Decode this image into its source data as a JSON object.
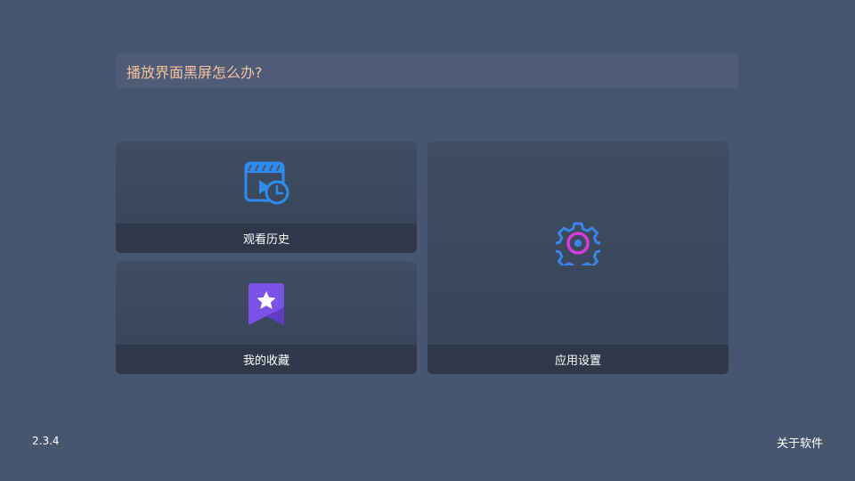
{
  "faq": {
    "question": "播放界面黑屏怎么办?"
  },
  "tiles": {
    "history": {
      "label": "观看历史",
      "icon": "clapperboard-clock-icon"
    },
    "favorites": {
      "label": "我的收藏",
      "icon": "bookmark-star-icon"
    },
    "settings": {
      "label": "应用设置",
      "icon": "gear-icon"
    }
  },
  "footer": {
    "version": "2.3.4",
    "about_label": "关于软件"
  },
  "colors": {
    "background": "#46566f",
    "faq_text": "#f6c3a1",
    "history_icon": "#2d8cf0",
    "favorites_icon": "#7b52e6",
    "settings_outer": "#3a86e8",
    "settings_inner": "#d63cd6"
  }
}
